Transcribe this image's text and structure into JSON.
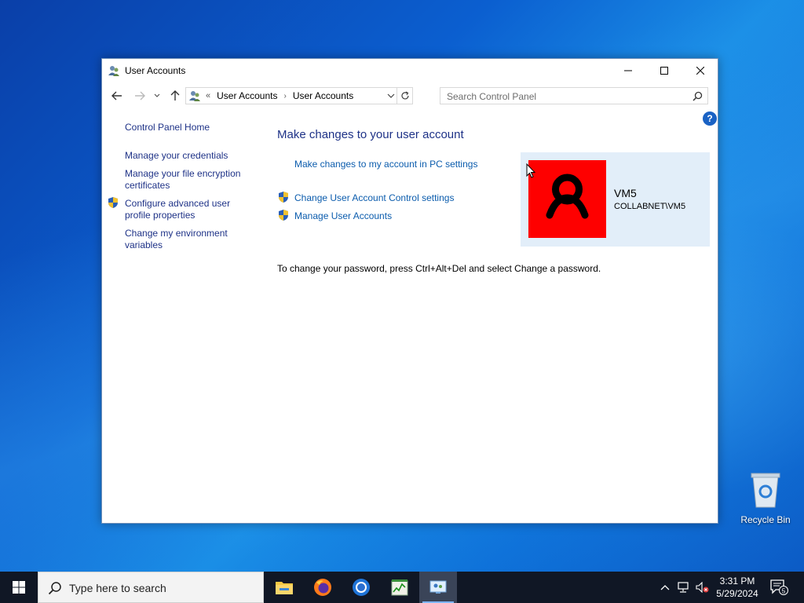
{
  "window": {
    "title": "User Accounts",
    "address": {
      "overflow": "«",
      "crumbs": [
        "User Accounts",
        "User Accounts"
      ]
    },
    "search_placeholder": "Search Control Panel"
  },
  "leftpane": {
    "home": "Control Panel Home",
    "links": [
      "Manage your credentials",
      "Manage your file encryption certificates",
      "Configure advanced user profile properties",
      "Change my environment variables"
    ]
  },
  "main": {
    "title": "Make changes to your user account",
    "links": [
      "Make changes to my account in PC settings",
      "Change User Account Control settings",
      "Manage User Accounts"
    ],
    "password_hint": "To change your password, press Ctrl+Alt+Del and select Change a password.",
    "help": "?"
  },
  "user": {
    "name": "VM5",
    "domain": "COLLABNET\\VM5",
    "avatar_color": "#fe0000"
  },
  "desktop": {
    "recycle_bin": "Recycle Bin"
  },
  "taskbar": {
    "search_placeholder": "Type here to search",
    "apps": [
      "file-explorer-icon",
      "firefox-icon",
      "chrome-icon",
      "task-manager-icon",
      "control-panel-icon"
    ],
    "time": "3:31 PM",
    "date": "5/29/2024",
    "notification_count": "5"
  },
  "colors": {
    "link": "#0b5cad",
    "heading": "#1e3287",
    "card": "#e2eef9"
  }
}
